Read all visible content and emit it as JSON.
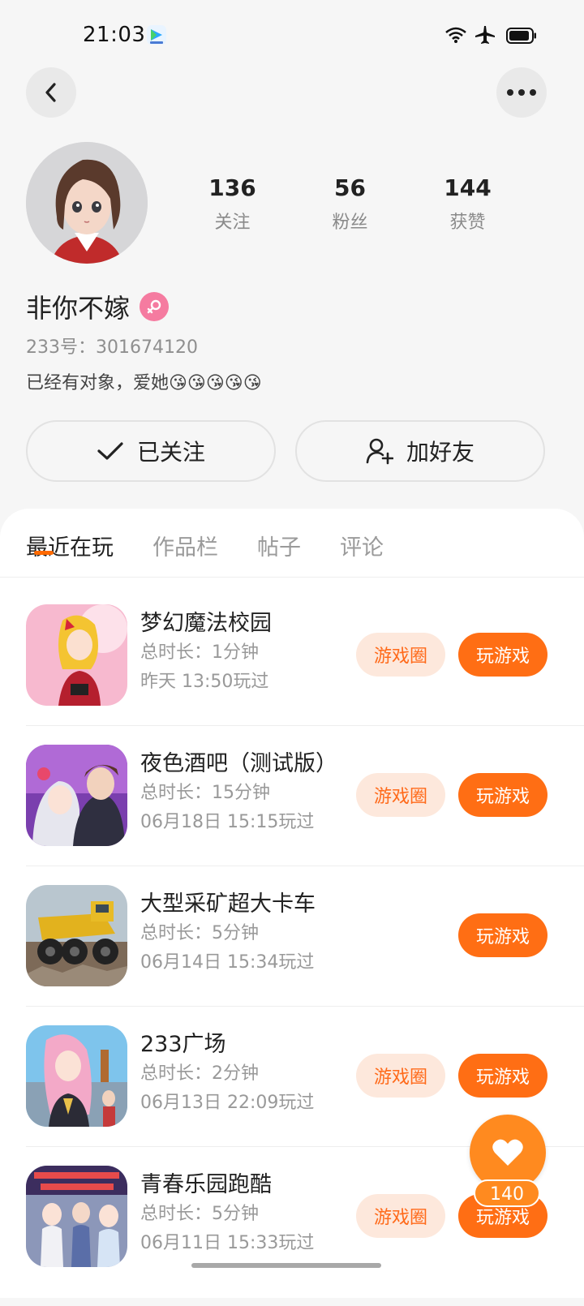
{
  "status_bar": {
    "time": "21:03"
  },
  "profile": {
    "stats": [
      {
        "value": "136",
        "label": "关注"
      },
      {
        "value": "56",
        "label": "粉丝"
      },
      {
        "value": "144",
        "label": "获赞"
      }
    ],
    "username": "非你不嫁",
    "uid": "233号：301674120",
    "bio": "已经有对象，爱她😘😘😘😘😘"
  },
  "actions": {
    "follow_label": "已关注",
    "add_friend_label": "加好友"
  },
  "tabs": [
    {
      "label": "最近在玩"
    },
    {
      "label": "作品栏"
    },
    {
      "label": "帖子"
    },
    {
      "label": "评论"
    }
  ],
  "games": [
    {
      "title": "梦幻魔法校园",
      "duration": "总时长：1分钟",
      "last_played": "昨天 13:50玩过",
      "circle_label": "游戏圈",
      "play_label": "玩游戏"
    },
    {
      "title": "夜色酒吧（测试版）",
      "duration": "总时长：15分钟",
      "last_played": "06月18日 15:15玩过",
      "circle_label": "游戏圈",
      "play_label": "玩游戏"
    },
    {
      "title": "大型采矿超大卡车",
      "duration": "总时长：5分钟",
      "last_played": "06月14日 15:34玩过",
      "circle_label": "",
      "play_label": "玩游戏"
    },
    {
      "title": "233广场",
      "duration": "总时长：2分钟",
      "last_played": "06月13日 22:09玩过",
      "circle_label": "游戏圈",
      "play_label": "玩游戏"
    },
    {
      "title": "青春乐园跑酷",
      "duration": "总时长：5分钟",
      "last_played": "06月11日 15:33玩过",
      "circle_label": "游戏圈",
      "play_label": "玩游戏"
    }
  ],
  "like_fab": {
    "count": "140"
  },
  "colors": {
    "accent": "#ff6e14",
    "accent_light": "#fde8dc",
    "fab": "#ff8a1f",
    "gender_female": "#f57ba0"
  }
}
